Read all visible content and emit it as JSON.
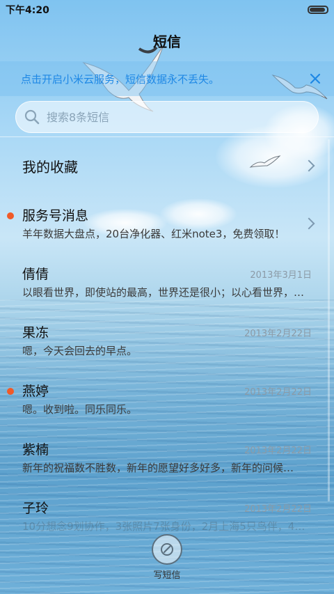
{
  "status_bar": {
    "time": "下午4:20",
    "battery_level": 0.92
  },
  "header": {
    "title": "短信"
  },
  "banner": {
    "text": "点击开启小米云服务，短信数据永不丢失。",
    "close_icon": "close-icon"
  },
  "search": {
    "placeholder": "搜索8条短信",
    "icon": "search-icon"
  },
  "favorites": {
    "label": "我的收藏"
  },
  "conversations": [
    {
      "name": "服务号消息",
      "preview": "羊年数据大盘点，20台净化器、红米note3，免费领取！",
      "date": "",
      "unread": true,
      "chevron": true
    },
    {
      "name": "倩倩",
      "preview": "以眼看世界，即使站的最高，世界还是很小；以心看世界，…",
      "date": "2013年3月1日",
      "unread": false
    },
    {
      "name": "果冻",
      "preview": "嗯，今天会回去的早点。",
      "date": "2013年2月22日",
      "unread": false
    },
    {
      "name": "燕婷",
      "preview": "嗯。收到啦。同乐同乐。",
      "date": "2013年2月22日",
      "unread": true
    },
    {
      "name": "紫楠",
      "preview": "新年的祝福数不胜数，新年的愿望好多好多，新年的问候…",
      "date": "2013年2月22日",
      "unread": false
    },
    {
      "name": "子玲",
      "preview": "10分想念9划协作，3张照片7张身份，2月上海5只鸟伴，4…",
      "date": "2013年2月22日",
      "unread": false
    }
  ],
  "compose": {
    "label": "写短信",
    "icon": "compose-pen-icon"
  },
  "colors": {
    "accent": "#1e88e5",
    "unread_dot": "#f05a28"
  }
}
